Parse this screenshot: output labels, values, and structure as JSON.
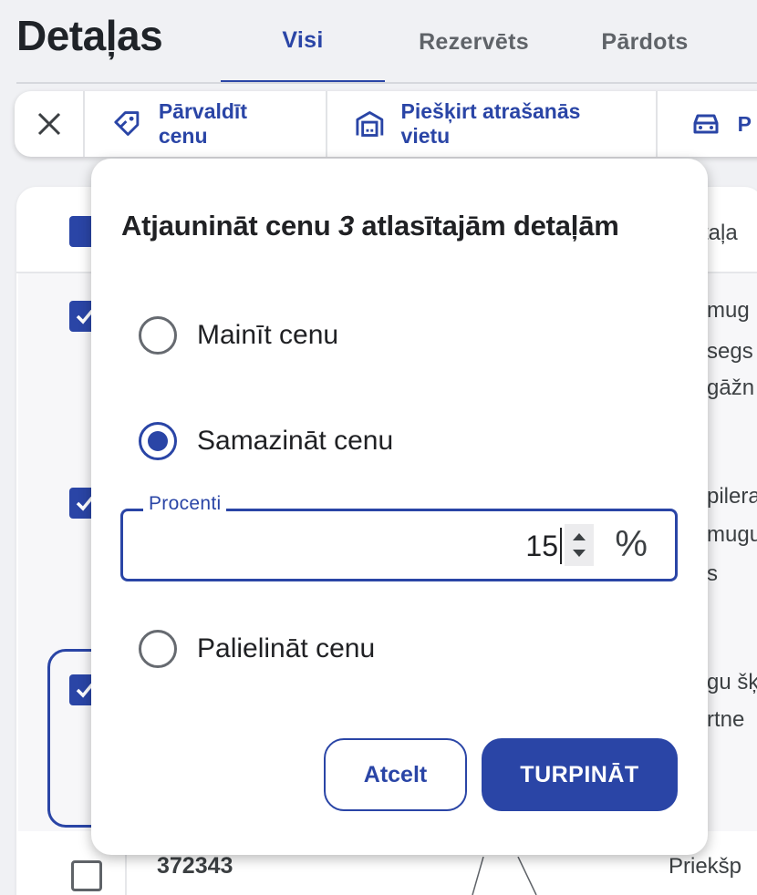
{
  "page": {
    "title": "Detaļas"
  },
  "tabs": [
    {
      "label": "Visi",
      "active": true
    },
    {
      "label": "Rezervēts",
      "active": false
    },
    {
      "label": "Pārdots",
      "active": false
    }
  ],
  "toolbar": {
    "close_icon": "close-icon",
    "actions": [
      {
        "label": "Pārvaldīt cenu",
        "icon": "price-tag-icon"
      },
      {
        "label": "Piešķirt atrašanās vietu",
        "icon": "garage-icon"
      },
      {
        "label": "P",
        "icon": "car-icon"
      }
    ]
  },
  "table_background": {
    "header_partial": "taļa",
    "row1_partial": [
      "mug",
      "segs",
      "gāžn"
    ],
    "row2_partial": [
      "pilera",
      "mugu",
      "s"
    ],
    "row3_partial": [
      "gu šķ",
      "rtne"
    ],
    "last_row_code": "372343",
    "last_row_partial": "Priekšp"
  },
  "dialog": {
    "title_prefix": "Atjaunināt cenu ",
    "title_count": "3",
    "title_suffix": " atlasītajām detaļām",
    "options": [
      {
        "label": "Mainīt cenu",
        "selected": false
      },
      {
        "label": "Samazināt cenu",
        "selected": true
      },
      {
        "label": "Palielināt cenu",
        "selected": false
      }
    ],
    "percent_field": {
      "label": "Procenti",
      "value": "15",
      "unit": "%"
    },
    "cancel_label": "Atcelt",
    "continue_label": "TURPINĀT"
  },
  "colors": {
    "accent": "#2a45a6",
    "background": "#f0f1f4"
  }
}
